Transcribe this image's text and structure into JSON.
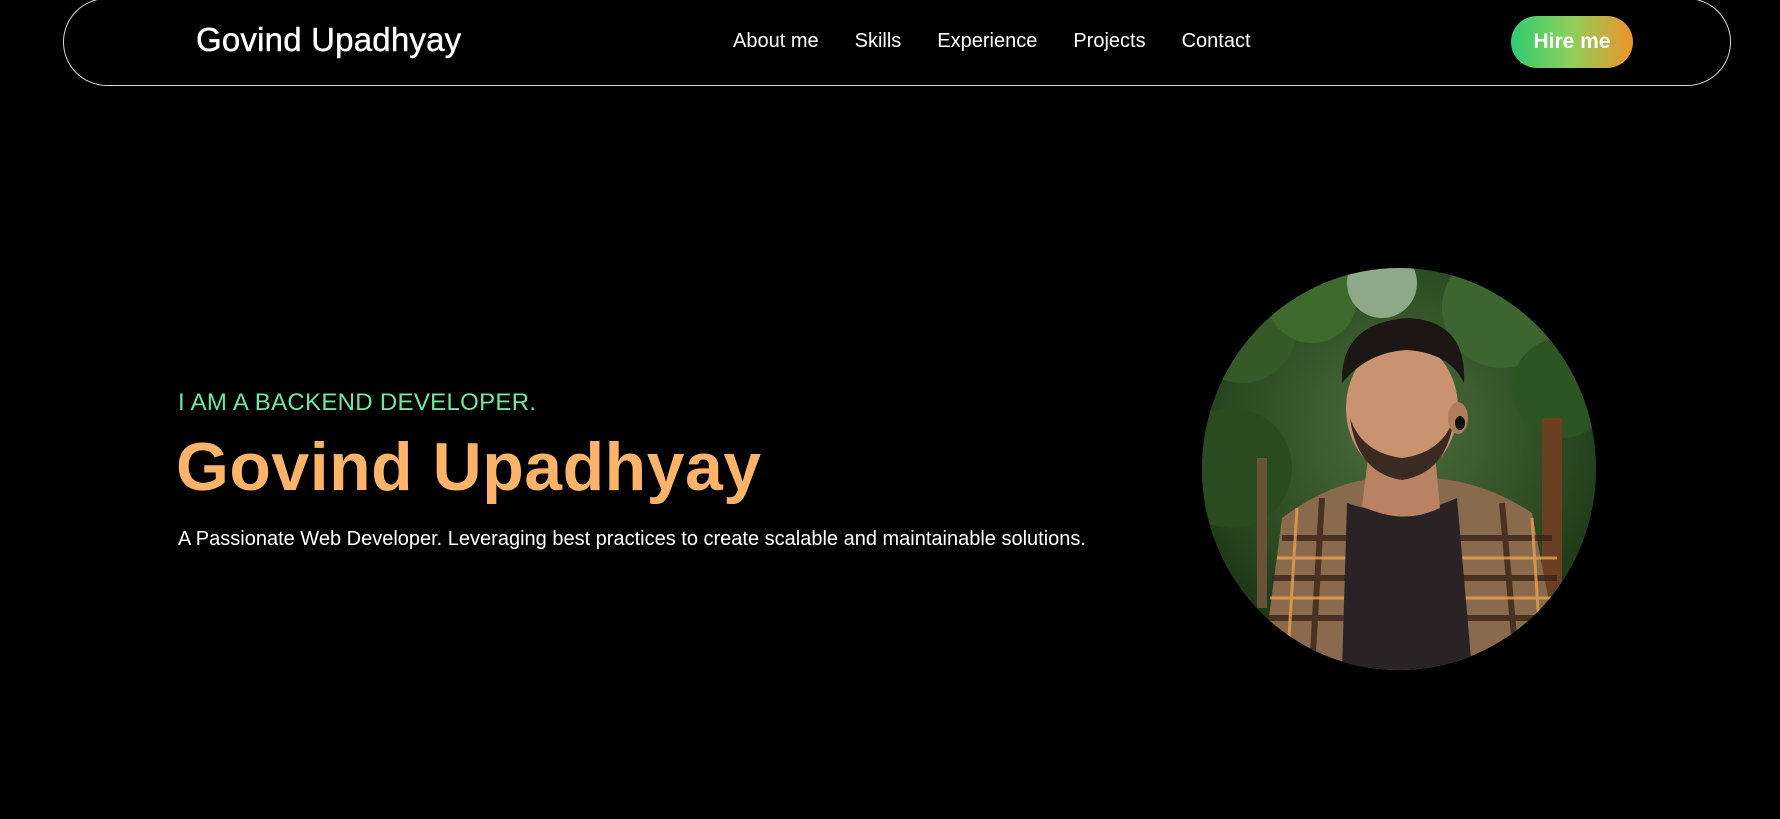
{
  "header": {
    "brand": "Govind Upadhyay",
    "nav": [
      {
        "label": "About me"
      },
      {
        "label": "Skills"
      },
      {
        "label": "Experience"
      },
      {
        "label": "Projects"
      },
      {
        "label": "Contact"
      }
    ],
    "hire_label": "Hire me"
  },
  "hero": {
    "tagline": "I AM A BACKEND DEVELOPER.",
    "name": "Govind Upadhyay",
    "description": "A Passionate Web Developer. Leveraging best practices to create scalable and maintainable solutions."
  },
  "colors": {
    "background": "#000000",
    "tagline": "#6ee7a5",
    "name": "#fdb469",
    "hire_gradient_start": "#2ecc71",
    "hire_gradient_end": "#f0922b"
  }
}
